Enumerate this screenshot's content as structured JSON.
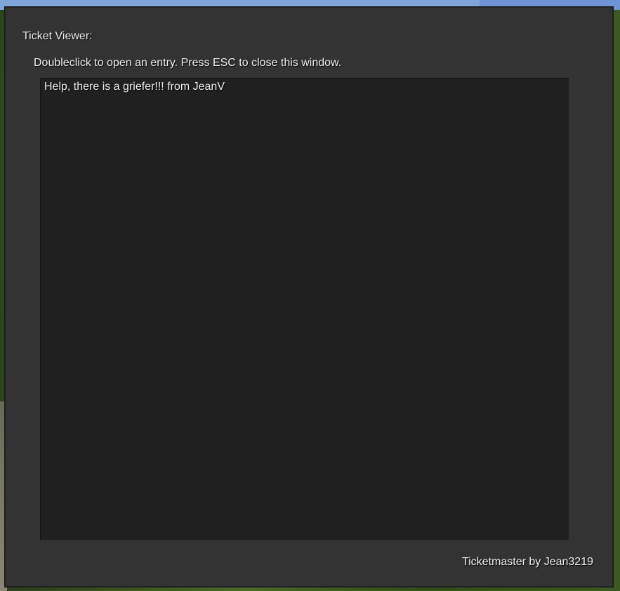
{
  "window": {
    "title": "Ticket Viewer:",
    "instructions": "Doubleclick to open an entry. Press ESC to close this window.",
    "credit": "Ticketmaster by Jean3219"
  },
  "tickets": [
    {
      "label": "Help, there is a griefer!!! from JeanV"
    }
  ],
  "colors": {
    "window_bg": "#333333",
    "list_bg": "#202020",
    "text": "#f0f0f0"
  }
}
